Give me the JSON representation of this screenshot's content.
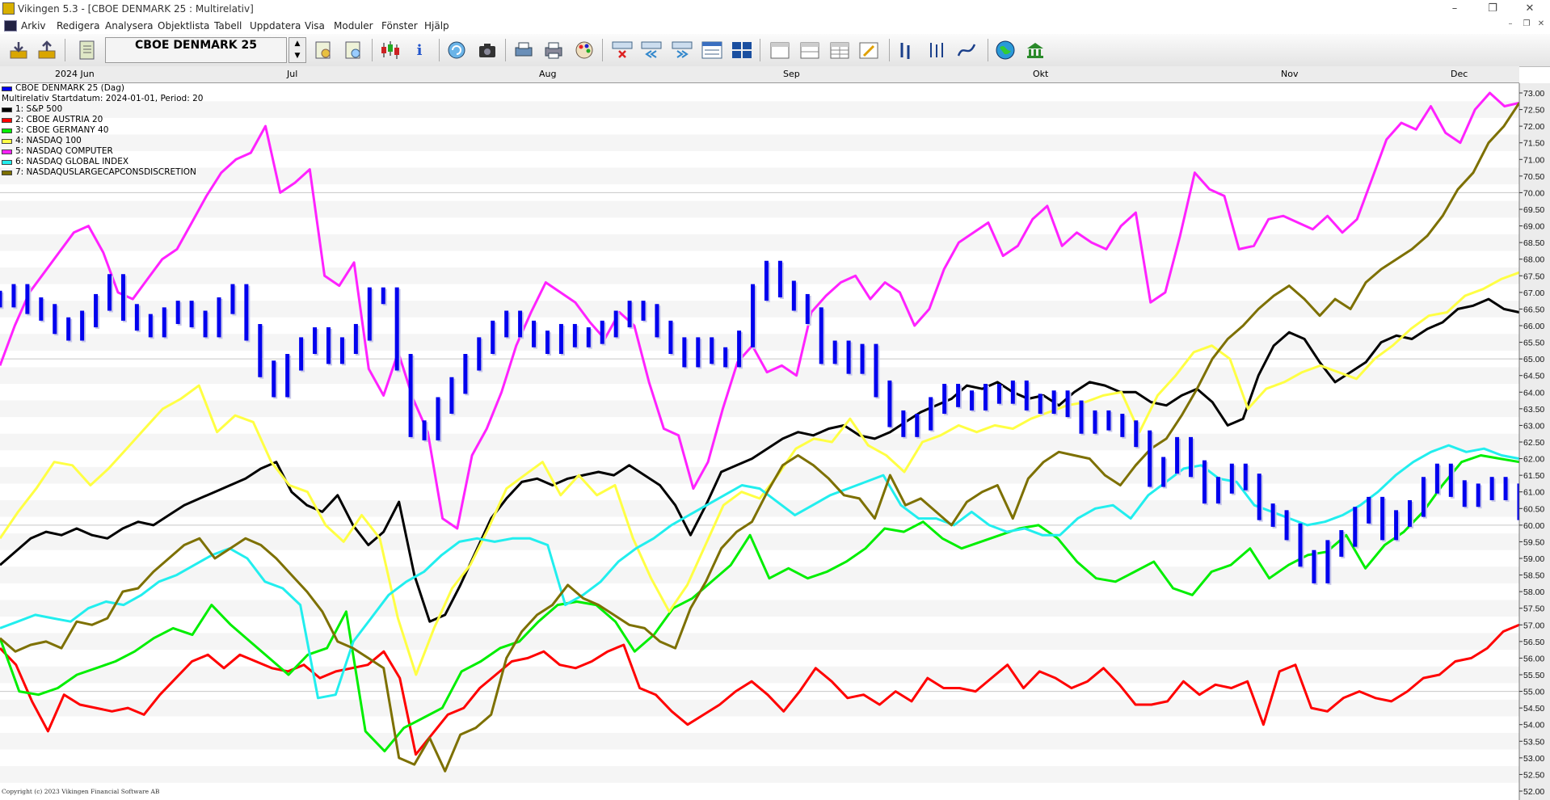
{
  "window": {
    "title": "Vikingen 5.3 - [CBOE DENMARK 25 : Multirelativ]",
    "minimize": "–",
    "maximize": "❐",
    "close": "✕"
  },
  "menu": {
    "items": [
      "Arkiv",
      "Redigera",
      "Analysera",
      "Objektlista",
      "Tabell",
      "Uppdatera",
      "Visa",
      "Moduler",
      "Fönster",
      "Hjälp"
    ],
    "mdi_min": "–",
    "mdi_restore": "❐",
    "mdi_close": "✕"
  },
  "toolbar": {
    "symbol": "CBOE DENMARK 25",
    "spin_up": "▲",
    "spin_down": "▼"
  },
  "date_axis": {
    "labels": [
      "2024 Jun",
      "Jul",
      "Aug",
      "Sep",
      "Okt",
      "Nov",
      "Dec"
    ]
  },
  "legend": {
    "main_series": "CBOE DENMARK 25 (Dag)",
    "subtitle": "Multirelativ Startdatum: 2024-01-01, Period: 20",
    "entries": [
      {
        "label": "1: S&P 500",
        "color": "#000000"
      },
      {
        "label": "2: CBOE AUSTRIA 20",
        "color": "#ff0000"
      },
      {
        "label": "3: CBOE GERMANY 40",
        "color": "#00ee00"
      },
      {
        "label": "4: NASDAQ 100",
        "color": "#ffff44"
      },
      {
        "label": "5: NASDAQ COMPUTER",
        "color": "#ff22ff"
      },
      {
        "label": "6: NASDAQ GLOBAL INDEX",
        "color": "#22eeee"
      },
      {
        "label": "7: NASDAQUSLARGECAPCONSDISCRETION",
        "color": "#7d7000"
      }
    ],
    "main_color": "#0000ee"
  },
  "copyright": "Copyright (c) 2023 Vikingen Financial Software AB",
  "chart_data": {
    "type": "line",
    "ylim": [
      52.0,
      73.0
    ],
    "y_ticks": [
      "52.00",
      "52.50",
      "53.00",
      "53.50",
      "54.00",
      "54.50",
      "55.00",
      "55.50",
      "56.00",
      "56.50",
      "57.00",
      "57.50",
      "58.00",
      "58.50",
      "59.00",
      "59.50",
      "60.00",
      "60.50",
      "61.00",
      "61.50",
      "62.00",
      "62.50",
      "63.00",
      "63.50",
      "64.00",
      "64.50",
      "65.00",
      "65.50",
      "66.00",
      "66.50",
      "67.00",
      "67.50",
      "68.00",
      "68.50",
      "69.00",
      "69.50",
      "70.00",
      "70.50",
      "71.00",
      "71.50",
      "72.00",
      "72.50",
      "73.00"
    ],
    "x_label_positions": [
      0,
      20,
      40,
      60,
      80,
      100,
      120
    ],
    "ohlc": {
      "name": "CBOE DENMARK 25",
      "close": [
        66.8,
        67.0,
        66.6,
        66.4,
        66.0,
        65.8,
        66.2,
        66.7,
        67.3,
        66.4,
        66.1,
        65.9,
        66.3,
        66.5,
        66.2,
        65.9,
        66.6,
        67.0,
        65.8,
        64.7,
        64.1,
        64.9,
        65.4,
        65.7,
        65.1,
        65.4,
        65.8,
        66.9,
        66.9,
        64.9,
        62.9,
        62.8,
        63.6,
        64.2,
        64.9,
        65.4,
        65.9,
        66.2,
        65.9,
        65.6,
        65.4,
        65.8,
        65.6,
        65.7,
        65.9,
        66.2,
        66.5,
        66.4,
        65.9,
        65.4,
        65.0,
        65.4,
        65.1,
        65.0,
        65.6,
        67.0,
        67.7,
        67.1,
        66.7,
        66.3,
        65.1,
        65.3,
        64.8,
        65.2,
        64.1,
        63.2,
        62.9,
        63.1,
        63.6,
        64.0,
        63.8,
        63.7,
        64.0,
        63.9,
        64.1,
        63.7,
        63.6,
        63.8,
        63.5,
        63.0,
        63.2,
        63.1,
        62.9,
        62.6,
        61.4,
        61.8,
        62.4,
        61.7,
        60.9,
        61.2,
        61.6,
        61.3,
        60.4,
        60.2,
        59.8,
        59.0,
        58.5,
        59.3,
        59.6,
        60.3,
        60.6,
        59.8,
        60.2,
        60.5,
        61.2,
        61.6,
        61.1,
        60.8,
        61.0,
        61.2,
        61.0,
        60.4
      ]
    },
    "series": [
      {
        "name": "1: S&P 500",
        "values": [
          58.8,
          59.2,
          59.6,
          59.8,
          59.7,
          59.9,
          59.7,
          59.6,
          59.9,
          60.1,
          60.0,
          60.3,
          60.6,
          60.8,
          61.0,
          61.2,
          61.4,
          61.7,
          61.9,
          61.0,
          60.6,
          60.4,
          60.9,
          60.0,
          59.4,
          59.8,
          60.7,
          58.5,
          57.1,
          57.3,
          58.2,
          59.2,
          60.2,
          60.8,
          61.3,
          61.4,
          61.2,
          61.4,
          61.5,
          61.6,
          61.5,
          61.8,
          61.5,
          61.2,
          60.6,
          59.7,
          60.6,
          61.6,
          61.8,
          62.0,
          62.3,
          62.6,
          62.8,
          62.7,
          62.9,
          63.0,
          62.7,
          62.6,
          62.8,
          63.1,
          63.4,
          63.6,
          63.8,
          64.2,
          64.1,
          64.3,
          64.0,
          63.8,
          63.9,
          63.6,
          64.0,
          64.3,
          64.2,
          64.0,
          64.0,
          63.7,
          63.6,
          63.9,
          64.1,
          63.7,
          63.0,
          63.2,
          64.5,
          65.4,
          65.8,
          65.6,
          64.9,
          64.3,
          64.6,
          64.9,
          65.5,
          65.7,
          65.6,
          65.9,
          66.1,
          66.5,
          66.6,
          66.8,
          66.5,
          66.4
        ]
      },
      {
        "name": "2: CBOE AUSTRIA 20",
        "values": [
          56.3,
          55.8,
          54.7,
          53.8,
          54.9,
          54.6,
          54.5,
          54.4,
          54.5,
          54.3,
          54.9,
          55.4,
          55.9,
          56.1,
          55.7,
          56.1,
          55.9,
          55.7,
          55.6,
          55.8,
          55.4,
          55.6,
          55.7,
          55.8,
          56.2,
          55.4,
          53.1,
          53.7,
          54.3,
          54.5,
          55.1,
          55.5,
          55.9,
          56.0,
          56.2,
          55.8,
          55.7,
          55.9,
          56.2,
          56.4,
          55.1,
          54.9,
          54.4,
          54.0,
          54.3,
          54.6,
          55.0,
          55.3,
          54.9,
          54.4,
          55.0,
          55.7,
          55.3,
          54.8,
          54.9,
          54.6,
          55.0,
          54.7,
          55.4,
          55.1,
          55.1,
          55.0,
          55.4,
          55.8,
          55.1,
          55.6,
          55.4,
          55.1,
          55.3,
          55.7,
          55.2,
          54.6,
          54.6,
          54.7,
          55.3,
          54.9,
          55.2,
          55.1,
          55.3,
          54.0,
          55.6,
          55.8,
          54.5,
          54.4,
          54.8,
          55.0,
          54.8,
          54.7,
          55.0,
          55.4,
          55.5,
          55.9,
          56.0,
          56.3,
          56.8,
          57.0
        ]
      },
      {
        "name": "3: CBOE GERMANY 40",
        "values": [
          56.6,
          55.0,
          54.9,
          55.1,
          55.5,
          55.7,
          55.9,
          56.2,
          56.6,
          56.9,
          56.7,
          57.6,
          57.0,
          56.5,
          56.0,
          55.5,
          56.1,
          56.3,
          57.4,
          53.8,
          53.2,
          53.9,
          54.2,
          54.5,
          55.6,
          55.9,
          56.3,
          56.5,
          57.1,
          57.6,
          57.7,
          57.6,
          57.1,
          56.2,
          56.7,
          57.5,
          57.8,
          58.3,
          58.8,
          59.7,
          58.4,
          58.7,
          58.4,
          58.6,
          58.9,
          59.3,
          59.9,
          59.8,
          60.1,
          59.6,
          59.3,
          59.5,
          59.7,
          59.9,
          60.0,
          59.6,
          58.9,
          58.4,
          58.3,
          58.6,
          58.9,
          58.1,
          57.9,
          58.6,
          58.8,
          59.3,
          58.4,
          58.8,
          59.1,
          59.2,
          59.7,
          58.7,
          59.4,
          59.8,
          60.4,
          61.2,
          61.9,
          62.1,
          62.0,
          61.9
        ]
      },
      {
        "name": "4: NASDAQ 100",
        "values": [
          59.6,
          60.4,
          61.1,
          61.9,
          61.8,
          61.2,
          61.7,
          62.3,
          62.9,
          63.5,
          63.8,
          64.2,
          62.8,
          63.3,
          63.1,
          61.9,
          61.2,
          61.0,
          60.0,
          59.5,
          60.3,
          59.6,
          57.2,
          55.5,
          56.9,
          58.1,
          58.8,
          59.9,
          61.1,
          61.5,
          61.9,
          60.9,
          61.5,
          60.9,
          61.2,
          59.6,
          58.4,
          57.4,
          58.2,
          59.4,
          60.6,
          61.0,
          60.8,
          61.5,
          62.3,
          62.6,
          62.5,
          63.2,
          62.4,
          62.1,
          61.6,
          62.5,
          62.7,
          63.0,
          62.8,
          63.0,
          62.9,
          63.2,
          63.4,
          63.6,
          63.7,
          63.9,
          64.0,
          62.8,
          63.9,
          64.5,
          65.2,
          65.4,
          65.0,
          63.5,
          64.1,
          64.3,
          64.6,
          64.8,
          64.6,
          64.4,
          65.0,
          65.4,
          65.9,
          66.3,
          66.4,
          66.9,
          67.1,
          67.4,
          67.6
        ]
      },
      {
        "name": "5: NASDAQ COMPUTER",
        "values": [
          64.8,
          66.0,
          67.0,
          67.6,
          68.2,
          68.8,
          69.0,
          68.2,
          67.0,
          66.8,
          67.4,
          68.0,
          68.3,
          69.1,
          69.9,
          70.6,
          71.0,
          71.2,
          72.0,
          70.0,
          70.3,
          70.7,
          67.5,
          67.2,
          67.9,
          64.7,
          63.9,
          65.2,
          63.8,
          62.8,
          60.2,
          59.9,
          62.1,
          62.9,
          64.0,
          65.4,
          66.4,
          67.3,
          67.0,
          66.7,
          66.1,
          65.6,
          66.4,
          66.0,
          64.3,
          62.9,
          62.7,
          61.1,
          61.9,
          63.5,
          64.9,
          65.4,
          64.6,
          64.8,
          64.5,
          66.4,
          66.9,
          67.3,
          67.5,
          66.8,
          67.3,
          67.0,
          66.0,
          66.5,
          67.7,
          68.5,
          68.8,
          69.1,
          68.1,
          68.4,
          69.2,
          69.6,
          68.4,
          68.8,
          68.5,
          68.3,
          69.0,
          69.4,
          66.7,
          67.0,
          68.7,
          70.6,
          70.1,
          69.9,
          68.3,
          68.4,
          69.2,
          69.3,
          69.1,
          68.9,
          69.3,
          68.8,
          69.2,
          70.4,
          71.6,
          72.1,
          71.9,
          72.6,
          71.8,
          71.5,
          72.5,
          73.0,
          72.6,
          72.7
        ]
      },
      {
        "name": "6: NASDAQ GLOBAL INDEX",
        "values": [
          56.9,
          57.1,
          57.3,
          57.2,
          57.1,
          57.5,
          57.7,
          57.6,
          57.9,
          58.3,
          58.5,
          58.8,
          59.1,
          59.3,
          59.0,
          58.3,
          58.1,
          57.6,
          54.8,
          54.9,
          56.5,
          57.2,
          57.9,
          58.3,
          58.6,
          59.1,
          59.5,
          59.6,
          59.5,
          59.6,
          59.6,
          59.4,
          57.6,
          57.9,
          58.3,
          58.9,
          59.3,
          59.6,
          60.0,
          60.3,
          60.6,
          60.9,
          61.2,
          61.1,
          60.7,
          60.3,
          60.6,
          60.9,
          61.1,
          61.3,
          61.5,
          60.6,
          60.2,
          60.2,
          60.0,
          60.4,
          60.0,
          59.8,
          59.9,
          59.7,
          59.7,
          60.2,
          60.5,
          60.6,
          60.2,
          60.9,
          61.3,
          61.7,
          61.8,
          61.4,
          61.3,
          60.6,
          60.4,
          60.2,
          60.0,
          60.1,
          60.3,
          60.6,
          61.0,
          61.5,
          61.9,
          62.2,
          62.4,
          62.2,
          62.3,
          62.1,
          62.0
        ]
      },
      {
        "name": "7: NASDAQUSLARGECAPCONSDISCRETION",
        "values": [
          56.6,
          56.2,
          56.4,
          56.5,
          56.3,
          57.1,
          57.0,
          57.2,
          58.0,
          58.1,
          58.6,
          59.0,
          59.4,
          59.6,
          59.0,
          59.3,
          59.6,
          59.4,
          59.0,
          58.5,
          58.0,
          57.4,
          56.5,
          56.3,
          56.0,
          55.7,
          53.0,
          52.8,
          53.6,
          52.6,
          53.7,
          53.9,
          54.3,
          56.0,
          56.8,
          57.3,
          57.6,
          58.2,
          57.8,
          57.6,
          57.3,
          57.0,
          56.9,
          56.5,
          56.3,
          57.5,
          58.3,
          59.3,
          59.8,
          60.1,
          61.0,
          61.8,
          62.1,
          61.8,
          61.4,
          60.9,
          60.8,
          60.2,
          61.5,
          60.6,
          60.8,
          60.4,
          60.0,
          60.7,
          61.0,
          61.2,
          60.2,
          61.4,
          61.9,
          62.2,
          62.1,
          62.0,
          61.5,
          61.2,
          61.8,
          62.3,
          62.6,
          63.3,
          64.1,
          65.0,
          65.6,
          66.0,
          66.5,
          66.9,
          67.2,
          66.8,
          66.3,
          66.8,
          66.5,
          67.3,
          67.7,
          68.0,
          68.3,
          68.7,
          69.3,
          70.1,
          70.6,
          71.5,
          72.0,
          72.7
        ]
      }
    ]
  }
}
